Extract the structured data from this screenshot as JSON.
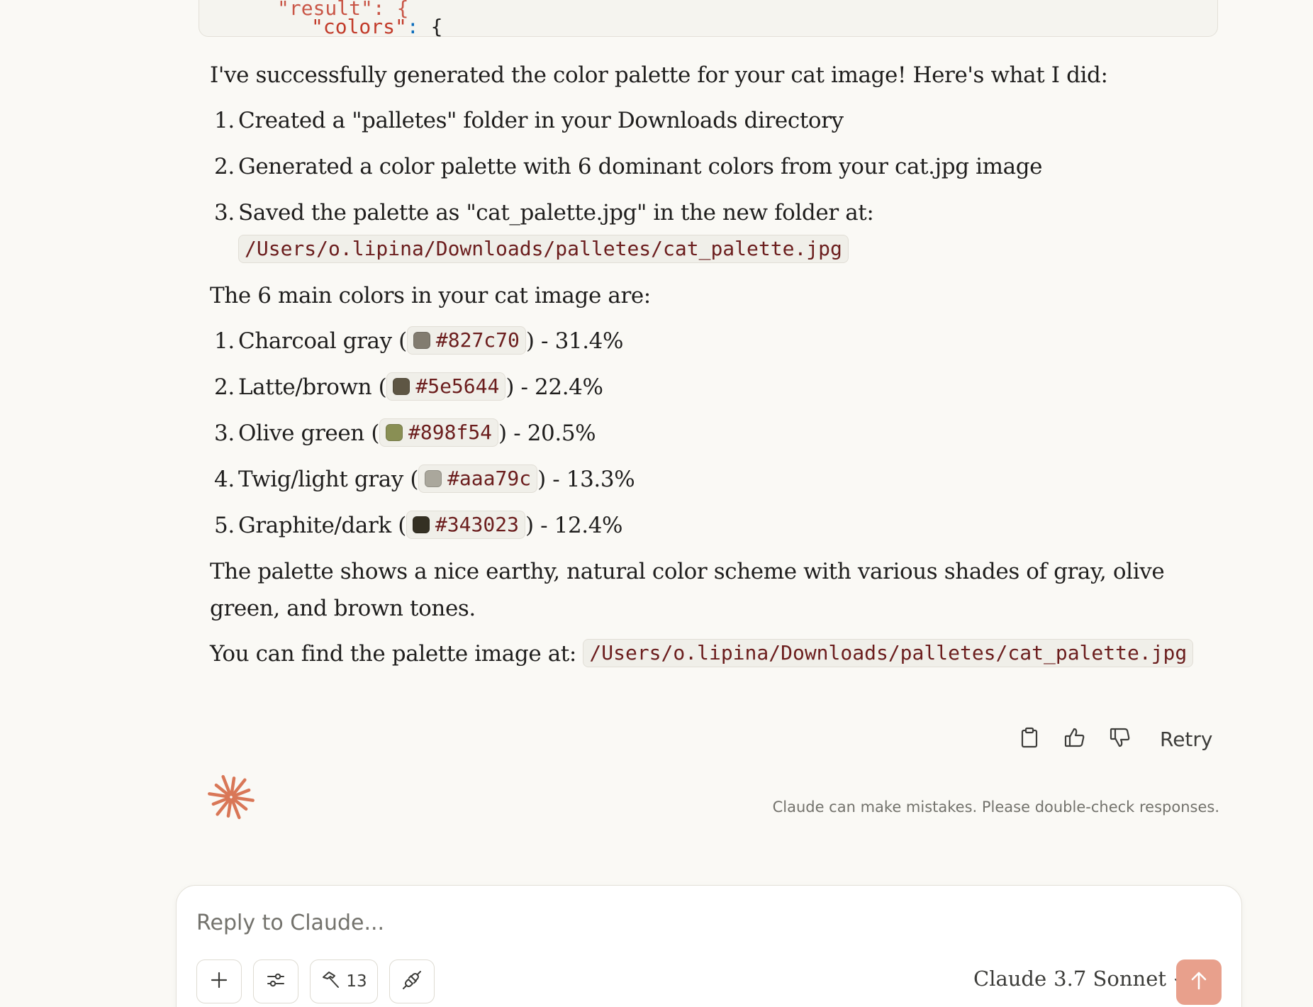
{
  "code_block": {
    "cut_line": "\"result\": {",
    "key": "\"colors\"",
    "punct": ":",
    "brace": "{"
  },
  "message": {
    "intro": "I've successfully generated the color palette for your cat image! Here's what I did:",
    "steps": [
      {
        "num": "1.",
        "text": "Created a \"palletes\" folder in your Downloads directory"
      },
      {
        "num": "2.",
        "text": "Generated a color palette with 6 dominant colors from your cat.jpg image"
      },
      {
        "num": "3.",
        "text": "Saved the palette as \"cat_palette.jpg\" in the new folder at:",
        "code": "/Users/o.lipina/Downloads/palletes/cat_palette.jpg"
      }
    ],
    "colors_intro": "The 6 main colors in your cat image are:",
    "colors": [
      {
        "num": "1.",
        "name": "Charcoal gray (",
        "hex": "#827c70",
        "suffix": ") - 31.4%"
      },
      {
        "num": "2.",
        "name": "Latte/brown (",
        "hex": "#5e5644",
        "suffix": ") - 22.4%"
      },
      {
        "num": "3.",
        "name": "Olive green (",
        "hex": "#898f54",
        "suffix": ") - 20.5%"
      },
      {
        "num": "4.",
        "name": "Twig/light gray (",
        "hex": "#aaa79c",
        "suffix": ") - 13.3%"
      },
      {
        "num": "5.",
        "name": "Graphite/dark (",
        "hex": "#343023",
        "suffix": ") - 12.4%"
      }
    ],
    "summary": "The palette shows a nice earthy, natural color scheme with various shades of gray, olive green, and brown tones.",
    "find_text": "You can find the palette image at:",
    "find_path": "/Users/o.lipina/Downloads/palletes/cat_palette.jpg"
  },
  "actions": {
    "copy_icon": "clipboard-icon",
    "like_icon": "thumbs-up-icon",
    "dislike_icon": "thumbs-down-icon",
    "retry_label": "Retry"
  },
  "disclaimer": "Claude can make mistakes. Please double-check responses.",
  "composer": {
    "placeholder": "Reply to Claude...",
    "tools_count": "13",
    "model_prefix": "Claude",
    "model_name": "3.7 Sonnet"
  },
  "colors": {
    "background": "#faf9f5",
    "accent": "#d97757",
    "send_button": "#e8a08c",
    "inline_code_text": "#6b1d1d"
  }
}
